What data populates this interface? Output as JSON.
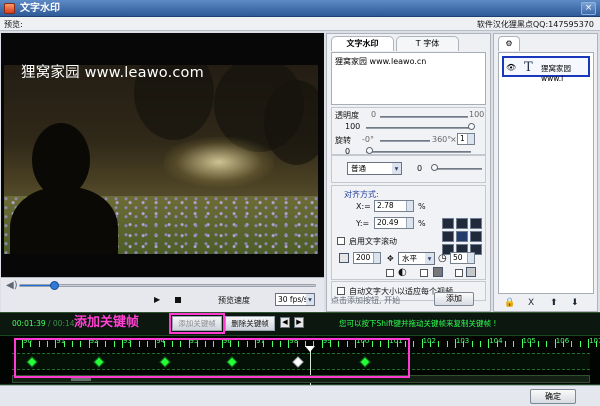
{
  "window": {
    "title": "文字水印",
    "close_symbol": "×"
  },
  "menubar": {
    "preview": "预览:",
    "credit": "软件汉化狸黑点QQ:147595370"
  },
  "video": {
    "watermark": "狸窝家园 www.leawo.com"
  },
  "player": {
    "play_symbol": "▶",
    "speed_label": "预览速度",
    "speed_value": "30 fps/s"
  },
  "panel": {
    "tabs": {
      "text": "文字水印",
      "font": "T 字体"
    },
    "text_value": "狸窝家园 www.leawo.cn",
    "opacity": {
      "label": "透明度",
      "min": "0",
      "max": "100",
      "value": "100"
    },
    "rotation": {
      "label": "旋转",
      "min": "-0°",
      "max": "360°",
      "multiplier_label": "×",
      "multiplier_value": "1",
      "value": "0"
    },
    "style_select": "普通",
    "style_value": "0",
    "alignment": {
      "label": "对齐方式:",
      "x_label": "X:=",
      "x_value": "2.78",
      "y_label": "Y:=",
      "y_value": "20.49",
      "unit": "%"
    },
    "scroll": {
      "label": "启用文字滚动",
      "size": "200",
      "direction": "水平",
      "speed": "50"
    },
    "auto_size": "自动文字大小以适应每个视频",
    "add_hint": "点击添加按钮, 开始",
    "add_button": "添加"
  },
  "layers": {
    "items": [
      {
        "name": "狸窝家园 www.l"
      }
    ],
    "tools": [
      "🔒",
      "X",
      "⬆",
      "⬇"
    ]
  },
  "timeline_toolbar": {
    "current_time": "00:01:39",
    "duration": "/ 00:14:",
    "annotation": "添加关键帧",
    "add_keyframe": "添加关键帧",
    "remove_keyframe": "删除关键帧",
    "prev": "◀",
    "next": "▶",
    "hint": "您可以按下Shift键并拖动关键帧来复制关键帧 !"
  },
  "timeline": {
    "labels": [
      "90",
      "91",
      "92",
      "93",
      "94",
      "95",
      "96",
      "97",
      "98",
      "99",
      "100",
      "101",
      "102",
      "103",
      "104",
      "105",
      "106",
      "107",
      "108",
      "109",
      "110",
      "111",
      "112"
    ],
    "keyframe_labels": [
      "90",
      "92",
      "94",
      "96",
      "98",
      "100"
    ],
    "selected_keyframe": "98"
  },
  "footer": {
    "ok": "确定"
  }
}
